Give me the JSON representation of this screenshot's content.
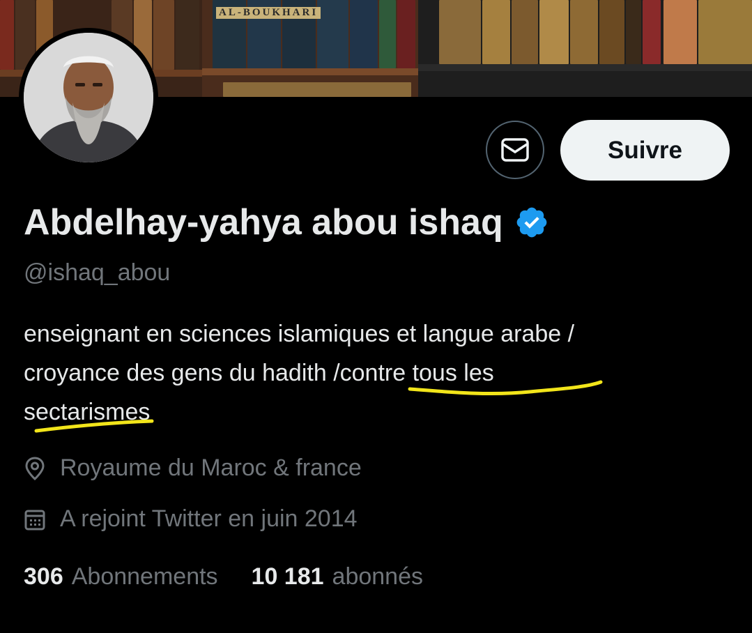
{
  "banner": {
    "book_spine_text": "AL-BOUKHARI"
  },
  "profile": {
    "display_name": "Abdelhay-yahya abou ishaq",
    "handle": "@ishaq_abou",
    "bio_lines": [
      "enseignant en sciences islamiques et langue arabe /",
      "croyance des gens du hadith /contre tous les",
      "sectarismes"
    ],
    "location": "Royaume du Maroc & france",
    "joined": "A rejoint Twitter en juin 2014",
    "verified_badge_color": "#1d9bf0"
  },
  "actions": {
    "follow_label": "Suivre",
    "message_icon": "envelope-icon"
  },
  "stats": {
    "following_count": "306",
    "following_label": "Abonnements",
    "followers_count": "10 181",
    "followers_label": "abonnés"
  },
  "annotation": {
    "highlight_color": "#f2e51a"
  },
  "icons": {
    "location": "map-pin-icon",
    "calendar": "calendar-icon",
    "verified": "verified-badge-icon"
  }
}
